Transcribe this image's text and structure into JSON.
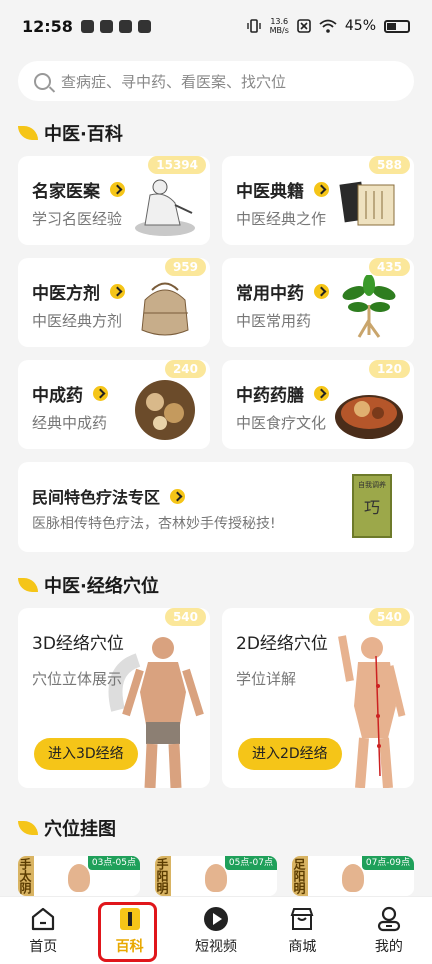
{
  "status_bar": {
    "time": "12:58",
    "net_speed_value": "13.6",
    "net_speed_unit": "MB/s",
    "battery": "45%"
  },
  "search": {
    "placeholder": "查病症、寻中药、看医案、找穴位"
  },
  "sections": {
    "encyclopedia": "中医·百科",
    "meridian": "中医·经络穴位",
    "charts": "穴位挂图"
  },
  "cards": [
    {
      "title": "名家医案",
      "subtitle": "学习名医经验",
      "count": "15394"
    },
    {
      "title": "中医典籍",
      "subtitle": "中医经典之作",
      "count": "588"
    },
    {
      "title": "中医方剂",
      "subtitle": "中医经典方剂",
      "count": "959"
    },
    {
      "title": "常用中药",
      "subtitle": "中医常用药",
      "count": "435"
    },
    {
      "title": "中成药",
      "subtitle": "经典中成药",
      "count": "240"
    },
    {
      "title": "中药药膳",
      "subtitle": "中医食疗文化",
      "count": "120"
    }
  ],
  "folk_card": {
    "title": "民间特色疗法专区",
    "subtitle": "医脉相传特色疗法，杏林妙手传授秘技!",
    "book_title": "自我调养",
    "book_char": "巧"
  },
  "meridian_cards": [
    {
      "title": "3D经络穴位",
      "subtitle": "穴位立体展示",
      "count": "540",
      "button": "进入3D经络"
    },
    {
      "title": "2D经络穴位",
      "subtitle": "学位详解",
      "count": "540",
      "button": "进入2D经络"
    }
  ],
  "chart_cards": [
    {
      "title": "手太阴肺",
      "time": "03点-05点"
    },
    {
      "title": "手阳明大",
      "time": "05点-07点"
    },
    {
      "title": "足阳明胃",
      "time": "07点-09点"
    }
  ],
  "nav": [
    {
      "label": "首页",
      "icon": "home-icon"
    },
    {
      "label": "百科",
      "icon": "book-icon"
    },
    {
      "label": "短视频",
      "icon": "play-icon"
    },
    {
      "label": "商城",
      "icon": "shop-icon"
    },
    {
      "label": "我的",
      "icon": "profile-icon"
    }
  ],
  "colors": {
    "accent": "#f5c518",
    "badge": "#fbe79a",
    "highlight": "#e0161b"
  }
}
